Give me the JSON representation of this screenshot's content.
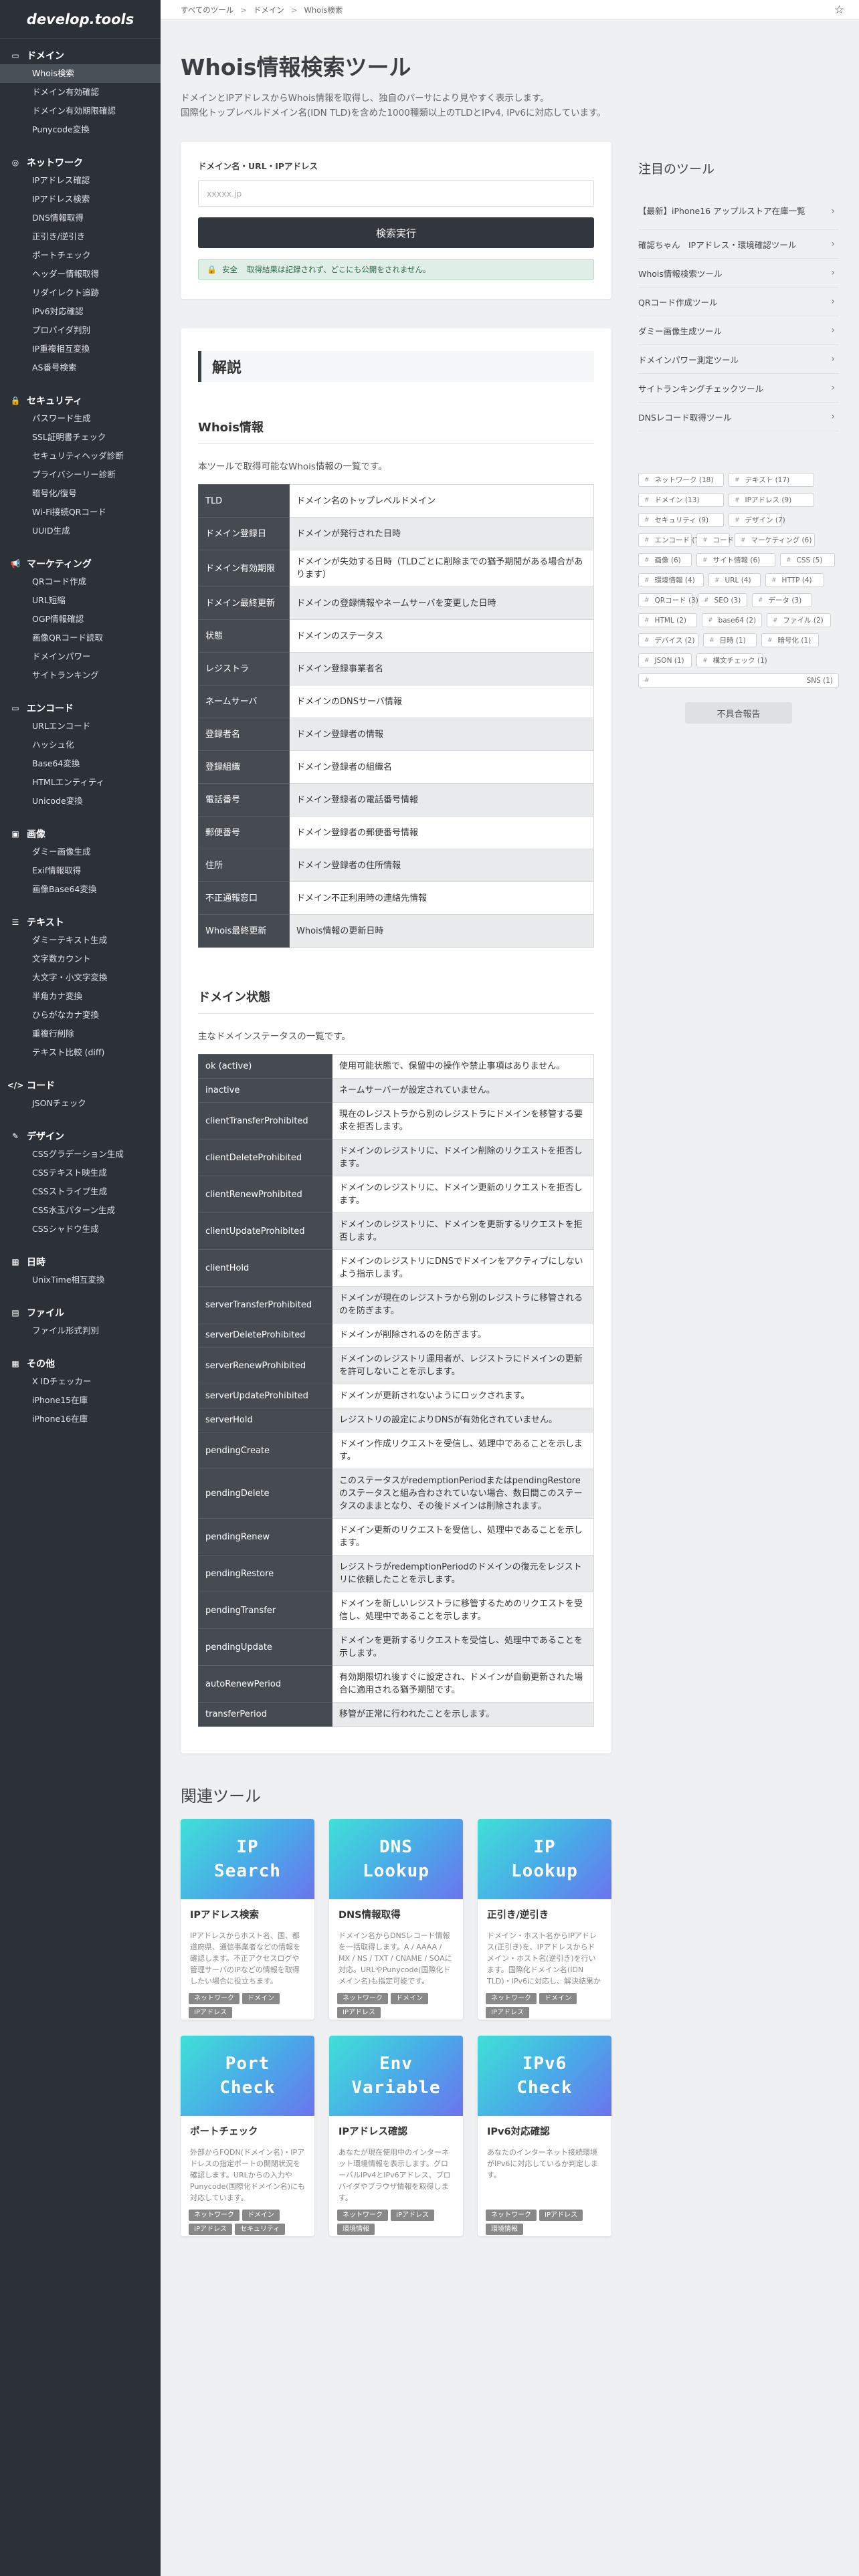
{
  "site": {
    "logo": "develop.tools"
  },
  "breadcrumb": [
    "すべてのツール",
    "ドメイン",
    "Whois検索"
  ],
  "sidebar": [
    {
      "icon": "domain-icon",
      "title": "ドメイン",
      "items": [
        "Whois検索",
        "ドメイン有効確認",
        "ドメイン有効期限確認",
        "Punycode変換"
      ]
    },
    {
      "icon": "globe-icon",
      "title": "ネットワーク",
      "items": [
        "IPアドレス確認",
        "IPアドレス検索",
        "DNS情報取得",
        "正引き/逆引き",
        "ポートチェック",
        "ヘッダー情報取得",
        "リダイレクト追跡",
        "IPv6対応確認",
        "プロバイダ判別",
        "IP重複相互変換",
        "AS番号検索"
      ]
    },
    {
      "icon": "lock-icon",
      "title": "セキュリティ",
      "items": [
        "パスワード生成",
        "SSL証明書チェック",
        "セキュリティヘッダ診断",
        "プライバシーリー診断",
        "暗号化/復号",
        "Wi-Fi接続QRコード",
        "UUID生成"
      ]
    },
    {
      "icon": "megaphone-icon",
      "title": "マーケティング",
      "items": [
        "QRコード作成",
        "URL短縮",
        "OGP情報確認",
        "画像QRコード読取",
        "ドメインパワー",
        "サイトランキング"
      ]
    },
    {
      "icon": "encode-icon",
      "title": "エンコード",
      "items": [
        "URLエンコード",
        "ハッシュ化",
        "Base64変換",
        "HTMLエンティティ",
        "Unicode変換"
      ]
    },
    {
      "icon": "image-icon",
      "title": "画像",
      "items": [
        "ダミー画像生成",
        "Exif情報取得",
        "画像Base64変換"
      ]
    },
    {
      "icon": "text-icon",
      "title": "テキスト",
      "items": [
        "ダミーテキスト生成",
        "文字数カウント",
        "大文字・小文字変換",
        "半角カナ変換",
        "ひらがなカナ変換",
        "重複行削除",
        "テキスト比較 (diff)"
      ]
    },
    {
      "icon": "code-icon",
      "title": "コード",
      "items": [
        "JSONチェック"
      ]
    },
    {
      "icon": "brush-icon",
      "title": "デザイン",
      "items": [
        "CSSグラデーション生成",
        "CSSテキスト映生成",
        "CSSストライプ生成",
        "CSS水玉パターン生成",
        "CSSシャドウ生成"
      ]
    },
    {
      "icon": "calendar-icon",
      "title": "日時",
      "items": [
        "UnixTime相互変換"
      ]
    },
    {
      "icon": "file-icon",
      "title": "ファイル",
      "items": [
        "ファイル形式判別"
      ]
    },
    {
      "icon": "grid-icon",
      "title": "その他",
      "items": [
        "X IDチェッカー",
        "iPhone15在庫",
        "iPhone16在庫"
      ]
    }
  ],
  "page": {
    "title": "Whois情報検索ツール",
    "intro": [
      "ドメインとIPアドレスからWhois情報を取得し、独自のパーサにより見やすく表示します。",
      "国際化トップレベルドメイン名(IDN TLD)を含めた1000種類以上のTLDとIPv4, IPv6に対応しています。"
    ]
  },
  "form": {
    "label": "ドメイン名・URL・IPアドレス",
    "placeholder": "xxxxx.jp",
    "button": "検索実行",
    "note_label": "安全",
    "note": "取得結果は記録されず、どこにも公開をされません。"
  },
  "explain": {
    "section_title": "解説",
    "whois_title": "Whois情報",
    "whois_desc": "本ツールで取得可能なWhois情報の一覧です。",
    "whois_rows": [
      [
        "TLD",
        "ドメイン名のトップレベルドメイン"
      ],
      [
        "ドメイン登録日",
        "ドメインが発行された日時"
      ],
      [
        "ドメイン有効期限",
        "ドメインが失効する日時（TLDごとに削除までの猶予期間がある場合があります）"
      ],
      [
        "ドメイン最終更新",
        "ドメインの登録情報やネームサーバを変更した日時"
      ],
      [
        "状態",
        "ドメインのステータス"
      ],
      [
        "レジストラ",
        "ドメイン登録事業者名"
      ],
      [
        "ネームサーバ",
        "ドメインのDNSサーバ情報"
      ],
      [
        "登録者名",
        "ドメイン登録者の情報"
      ],
      [
        "登録組織",
        "ドメイン登録者の組織名"
      ],
      [
        "電話番号",
        "ドメイン登録者の電話番号情報"
      ],
      [
        "郵便番号",
        "ドメイン登録者の郵便番号情報"
      ],
      [
        "住所",
        "ドメイン登録者の住所情報"
      ],
      [
        "不正通報窓口",
        "ドメイン不正利用時の連絡先情報"
      ],
      [
        "Whois最終更新",
        "Whois情報の更新日時"
      ]
    ],
    "status_title": "ドメイン状態",
    "status_desc": "主なドメインステータスの一覧です。",
    "status_rows": [
      [
        "ok (active)",
        "使用可能状態で、保留中の操作や禁止事項はありません。"
      ],
      [
        "inactive",
        "ネームサーバーが設定されていません。"
      ],
      [
        "clientTransferProhibited",
        "現在のレジストラから別のレジストラにドメインを移管する要求を拒否します。"
      ],
      [
        "clientDeleteProhibited",
        "ドメインのレジストリに、ドメイン削除のリクエストを拒否します。"
      ],
      [
        "clientRenewProhibited",
        "ドメインのレジストリに、ドメイン更新のリクエストを拒否します。"
      ],
      [
        "clientUpdateProhibited",
        "ドメインのレジストリに、ドメインを更新するリクエストを拒否します。"
      ],
      [
        "clientHold",
        "ドメインのレジストリにDNSでドメインをアクティブにしないよう指示します。"
      ],
      [
        "serverTransferProhibited",
        "ドメインが現在のレジストラから別のレジストラに移管されるのを防ぎます。"
      ],
      [
        "serverDeleteProhibited",
        "ドメインが削除されるのを防ぎます。"
      ],
      [
        "serverRenewProhibited",
        "ドメインのレジストリ運用者が、レジストラにドメインの更新を許可しないことを示します。"
      ],
      [
        "serverUpdateProhibited",
        "ドメインが更新されないようにロックされます。"
      ],
      [
        "serverHold",
        "レジストリの設定によりDNSが有効化されていません。"
      ],
      [
        "pendingCreate",
        "ドメイン作成リクエストを受信し、処理中であることを示します。"
      ],
      [
        "pendingDelete",
        "このステータスがredemptionPeriodまたはpendingRestoreのステータスと組み合わされていない場合、数日間このステータスのままとなり、その後ドメインは削除されます。"
      ],
      [
        "pendingRenew",
        "ドメイン更新のリクエストを受信し、処理中であることを示します。"
      ],
      [
        "pendingRestore",
        "レジストラがredemptionPeriodのドメインの復元をレジストリに依頼したことを示します。"
      ],
      [
        "pendingTransfer",
        "ドメインを新しいレジストラに移管するためのリクエストを受信し、処理中であることを示します。"
      ],
      [
        "pendingUpdate",
        "ドメインを更新するリクエストを受信し、処理中であることを示します。"
      ],
      [
        "autoRenewPeriod",
        "有効期限切れ後すぐに設定され、ドメインが自動更新された場合に適用される猶予期間です。"
      ],
      [
        "transferPeriod",
        "移管が正常に行われたことを示します。"
      ]
    ]
  },
  "related": {
    "title": "関連ツール",
    "tools": [
      {
        "img": [
          "IP",
          "Search"
        ],
        "title": "IPアドレス検索",
        "desc": "IPアドレスからホスト名、国、都道府県、通信事業者などの情報を確認します。不正アクセスログや管理サーバのIPなどの情報を取得したい場合に役立ちます。",
        "tags": [
          "ネットワーク",
          "ドメイン",
          "IPアドレス"
        ]
      },
      {
        "img": [
          "DNS",
          "Lookup"
        ],
        "title": "DNS情報取得",
        "desc": "ドメイン名からDNSレコード情報を一括取得します。A / AAAA / MX / NS / TXT / CNAME / SOAに対応。URLやPunycode(国際化ドメイン名)も指定可能です。",
        "tags": [
          "ネットワーク",
          "ドメイン",
          "IPアドレス"
        ]
      },
      {
        "img": [
          "IP",
          "Lookup"
        ],
        "title": "正引き/逆引き",
        "desc": "ドメイン・ホスト名からIPアドレス(正引き)を、IPアドレスからドメイン・ホスト名(逆引き)を行います。国際化ドメイン名(IDN TLD)・IPv6に対応し、解決結果からさらに正引き・逆引きが可能。",
        "tags": [
          "ネットワーク",
          "ドメイン",
          "IPアドレス"
        ]
      },
      {
        "img": [
          "Port",
          "Check"
        ],
        "title": "ポートチェック",
        "desc": "外部からFQDN(ドメイン名)・IPアドレスの指定ポートの開閉状況を確認します。URLからの入力やPunycode(国際化ドメイン名)にも対応しています。",
        "tags": [
          "ネットワーク",
          "ドメイン",
          "IPアドレス",
          "セキュリティ"
        ]
      },
      {
        "img": [
          "Env",
          "Variable"
        ],
        "title": "IPアドレス確認",
        "desc": "あなたが現在使用中のインターネット環境情報を表示します。グローバルIPv4とIPv6アドレス、プロバイダやブラウザ情報を取得します。",
        "tags": [
          "ネットワーク",
          "IPアドレス",
          "環境情報"
        ]
      },
      {
        "img": [
          "IPv6",
          "Check"
        ],
        "title": "IPv6対応確認",
        "desc": "あなたのインターネット接続環境がIPv6に対応しているか判定します。",
        "tags": [
          "ネットワーク",
          "IPアドレス",
          "環境情報"
        ]
      }
    ]
  },
  "right": {
    "title": "注目のツール",
    "featured": [
      "【最新】iPhone16 アップルストア在庫一覧",
      "確認ちゃん　IPアドレス・環境確認ツール",
      "Whois情報検索ツール",
      "QRコード作成ツール",
      "ダミー画像生成ツール",
      "ドメインパワー測定ツール",
      "サイトランキングチェックツール",
      "DNSレコード取得ツール"
    ],
    "tags": [
      "ネットワーク (18)",
      "テキスト (17)",
      "ドメイン (13)",
      "IPアドレス (9)",
      "セキュリティ (9)",
      "デザイン (7)",
      "エンコード (7)",
      "コード (7)",
      "マーケティング (6)",
      "画像 (6)",
      "サイト情報 (6)",
      "CSS (5)",
      "環境情報 (4)",
      "URL (4)",
      "HTTP (4)",
      "QRコード (3)",
      "SEO (3)",
      "データ (3)",
      "HTML (2)",
      "base64 (2)",
      "ファイル (2)",
      "デバイス (2)",
      "日時 (1)",
      "暗号化 (1)",
      "JSON (1)",
      "構文チェック (1)",
      "SNS (1)"
    ],
    "report": "不具合報告"
  },
  "colors": {
    "sidebar_bg": "#2c3138",
    "header_cell": "#464b52",
    "accent_button": "#32373d",
    "tile_gradient": [
      "#3fe0d8",
      "#6b74ee"
    ]
  }
}
